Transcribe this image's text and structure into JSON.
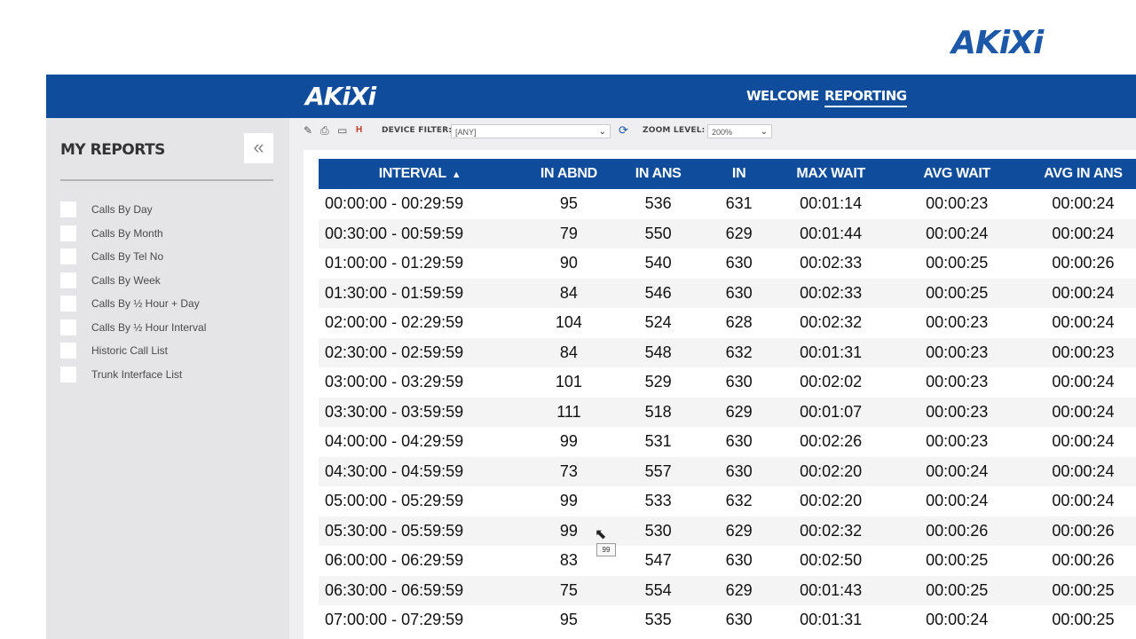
{
  "brand": {
    "corner_logo": "AKiXi",
    "app_logo": "AKiXi"
  },
  "nav": {
    "welcome": "WELCOME",
    "reporting": "REPORTING"
  },
  "sidebar": {
    "title": "MY REPORTS",
    "collapse_icon": "«",
    "items": [
      {
        "label": "Calls By Day"
      },
      {
        "label": "Calls By Month"
      },
      {
        "label": "Calls By Tel No"
      },
      {
        "label": "Calls By Week"
      },
      {
        "label": "Calls By ½ Hour + Day"
      },
      {
        "label": "Calls By ½ Hour Interval"
      },
      {
        "label": "Historic Call List"
      },
      {
        "label": "Trunk Interface List"
      }
    ]
  },
  "toolbar": {
    "icons": [
      "edit-icon",
      "print-icon",
      "monitor-icon",
      "export-icon",
      "refresh-icon"
    ],
    "device_filter_label": "DEVICE FILTER:",
    "device_filter_value": "[ANY]",
    "zoom_label": "ZOOM LEVEL:",
    "zoom_value": "200%"
  },
  "table": {
    "headers": [
      "INTERVAL",
      "IN ABND",
      "IN ANS",
      "IN",
      "MAX WAIT",
      "AVG WAIT",
      "AVG IN ANS"
    ],
    "sort_indicator": "▲",
    "rows": [
      [
        "00:00:00 - 00:29:59",
        "95",
        "536",
        "631",
        "00:01:14",
        "00:00:23",
        "00:00:24"
      ],
      [
        "00:30:00 - 00:59:59",
        "79",
        "550",
        "629",
        "00:01:44",
        "00:00:24",
        "00:00:24"
      ],
      [
        "01:00:00 - 01:29:59",
        "90",
        "540",
        "630",
        "00:02:33",
        "00:00:25",
        "00:00:26"
      ],
      [
        "01:30:00 - 01:59:59",
        "84",
        "546",
        "630",
        "00:02:33",
        "00:00:25",
        "00:00:24"
      ],
      [
        "02:00:00 - 02:29:59",
        "104",
        "524",
        "628",
        "00:02:32",
        "00:00:23",
        "00:00:24"
      ],
      [
        "02:30:00 - 02:59:59",
        "84",
        "548",
        "632",
        "00:01:31",
        "00:00:23",
        "00:00:23"
      ],
      [
        "03:00:00 - 03:29:59",
        "101",
        "529",
        "630",
        "00:02:02",
        "00:00:23",
        "00:00:24"
      ],
      [
        "03:30:00 - 03:59:59",
        "111",
        "518",
        "629",
        "00:01:07",
        "00:00:23",
        "00:00:24"
      ],
      [
        "04:00:00 - 04:29:59",
        "99",
        "531",
        "630",
        "00:02:26",
        "00:00:23",
        "00:00:24"
      ],
      [
        "04:30:00 - 04:59:59",
        "73",
        "557",
        "630",
        "00:02:20",
        "00:00:24",
        "00:00:24"
      ],
      [
        "05:00:00 - 05:29:59",
        "99",
        "533",
        "632",
        "00:02:20",
        "00:00:24",
        "00:00:24"
      ],
      [
        "05:30:00 - 05:59:59",
        "99",
        "530",
        "629",
        "00:02:32",
        "00:00:26",
        "00:00:26"
      ],
      [
        "06:00:00 - 06:29:59",
        "83",
        "547",
        "630",
        "00:02:50",
        "00:00:25",
        "00:00:26"
      ],
      [
        "06:30:00 - 06:59:59",
        "75",
        "554",
        "629",
        "00:01:43",
        "00:00:25",
        "00:00:25"
      ],
      [
        "07:00:00 - 07:29:59",
        "95",
        "535",
        "630",
        "00:01:31",
        "00:00:24",
        "00:00:25"
      ]
    ]
  },
  "tooltip": {
    "text": "99"
  }
}
